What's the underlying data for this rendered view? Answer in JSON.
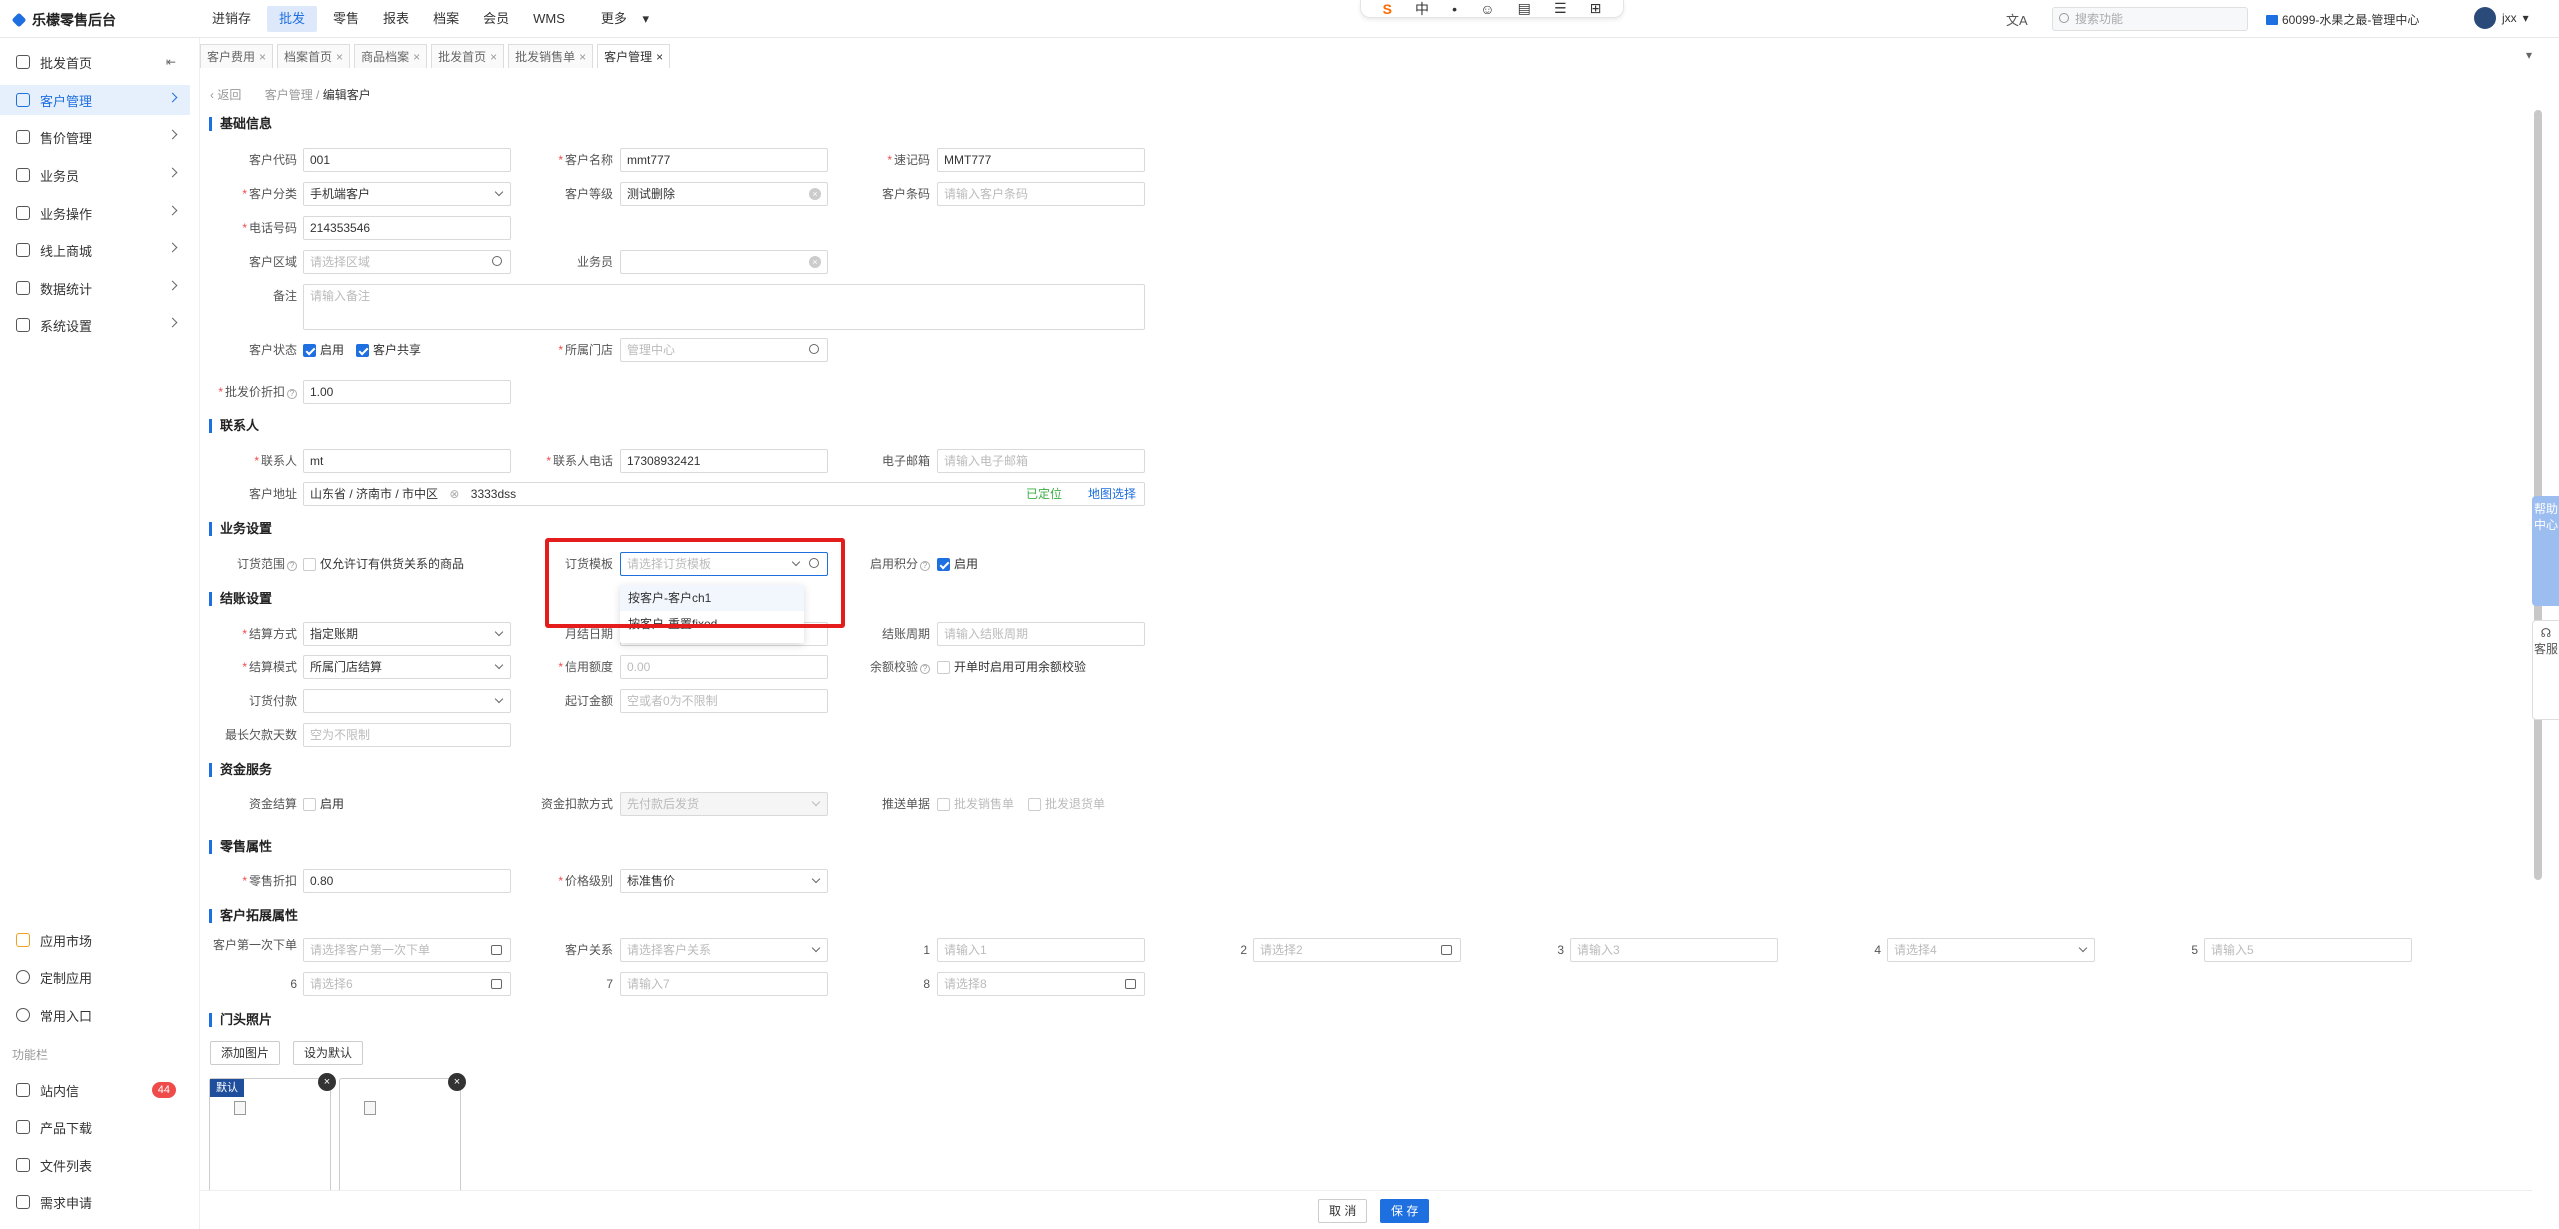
{
  "topbar": {
    "logo": "乐檬零售后台",
    "menu": [
      "进销存",
      "批发",
      "零售",
      "报表",
      "档案",
      "会员",
      "WMS",
      "更多"
    ],
    "search_placeholder": "搜索功能",
    "store": "60099-水果之最-管理中心",
    "user": "jxx",
    "ime": [
      "中",
      "•",
      "☺",
      "▤",
      "☰",
      "⊞"
    ]
  },
  "sidebar": {
    "items": [
      "批发首页",
      "客户管理",
      "售价管理",
      "业务员",
      "业务操作",
      "线上商城",
      "数据统计",
      "系统设置"
    ],
    "bottom": [
      "应用市场",
      "定制应用",
      "常用入口"
    ],
    "section_label": "功能栏",
    "tools": [
      "站内信",
      "产品下载",
      "文件列表",
      "需求申请"
    ],
    "msg_count": "44"
  },
  "tabs": [
    "客户费用",
    "档案首页",
    "商品档案",
    "批发首页",
    "批发销售单",
    "客户管理"
  ],
  "breadcrumb": {
    "back": "返回",
    "path": "客户管理 /",
    "current": "编辑客户"
  },
  "sections": {
    "basic": "基础信息",
    "contact": "联系人",
    "business": "业务设置",
    "settle": "结账设置",
    "fund": "资金服务",
    "retail": "零售属性",
    "ext": "客户拓展属性",
    "photo": "门头照片"
  },
  "basic": {
    "code_label": "客户代码",
    "code": "001",
    "name_label": "客户名称",
    "name": "mmt777",
    "mnemonic_label": "速记码",
    "mnemonic": "MMT777",
    "category_label": "客户分类",
    "category": "手机端客户",
    "level_label": "客户等级",
    "level": "测试删除",
    "barcode_label": "客户条码",
    "barcode_ph": "请输入客户条码",
    "phone_label": "电话号码",
    "phone": "214353546",
    "region_label": "客户区域",
    "region_ph": "请选择区域",
    "salesman_label": "业务员",
    "remark_label": "备注",
    "remark_ph": "请输入备注",
    "status_label": "客户状态",
    "enable": "启用",
    "shared": "客户共享",
    "store_label": "所属门店",
    "store_ph": "管理中心",
    "discount_label": "批发价折扣",
    "discount": "1.00"
  },
  "contact": {
    "person_label": "联系人",
    "person": "mt",
    "tel_label": "联系人电话",
    "tel": "17308932421",
    "email_label": "电子邮箱",
    "email_ph": "请输入电子邮箱",
    "addr_label": "客户地址",
    "addr_region": "山东省 / 济南市 / 市中区",
    "addr_detail": "3333dss",
    "located": "已定位",
    "map_select": "地图选择"
  },
  "business": {
    "scope_label": "订货范围",
    "scope_opt": "仅允许订有供货关系的商品",
    "template_label": "订货模板",
    "template_ph": "请选择订货模板",
    "template_options": [
      "按客户-客户ch1",
      "按客户-重置fixed"
    ],
    "points_label": "启用积分",
    "points_opt": "启用"
  },
  "settle": {
    "method_label": "结算方式",
    "method": "指定账期",
    "monthly_label": "月结日期",
    "period_label": "结账周期",
    "period_ph": "请输入结账周期",
    "mode_label": "结算模式",
    "mode": "所属门店结算",
    "credit_label": "信用额度",
    "credit_ph": "0.00",
    "balance_label": "余额校验",
    "balance_opt": "开单时启用可用余额校验",
    "payment_label": "订货付款",
    "min_label": "起订金额",
    "min_ph": "空或者0为不限制",
    "maxdays_label": "最长欠款天数",
    "maxdays_ph": "空为不限制"
  },
  "fund": {
    "settle_label": "资金结算",
    "settle_opt": "启用",
    "deduct_label": "资金扣款方式",
    "deduct_ph": "先付款后发货",
    "push_label": "推送单据",
    "push_opt1": "批发销售单",
    "push_opt2": "批发退货单"
  },
  "retail": {
    "discount_label": "零售折扣",
    "discount": "0.80",
    "price_label": "价格级别",
    "price": "标准售价"
  },
  "ext": {
    "first_label": "客户第一次下单",
    "first_ph": "请选择客户第一次下单",
    "rel_label": "客户关系",
    "rel_ph": "请选择客户关系",
    "f1": "1",
    "f1_ph": "请输入1",
    "f2": "2",
    "f2_ph": "请选择2",
    "f3": "3",
    "f3_ph": "请输入3",
    "f4": "4",
    "f4_ph": "请选择4",
    "f5": "5",
    "f5_ph": "请输入5",
    "f6": "6",
    "f6_ph": "请选择6",
    "f7": "7",
    "f7_ph": "请输入7",
    "f8": "8",
    "f8_ph": "请选择8"
  },
  "photo": {
    "add": "添加图片",
    "default": "设为默认",
    "tag": "默认"
  },
  "footer": {
    "cancel": "取 消",
    "save": "保 存"
  },
  "side_tools": {
    "help": "帮助中心",
    "service": "客服"
  }
}
